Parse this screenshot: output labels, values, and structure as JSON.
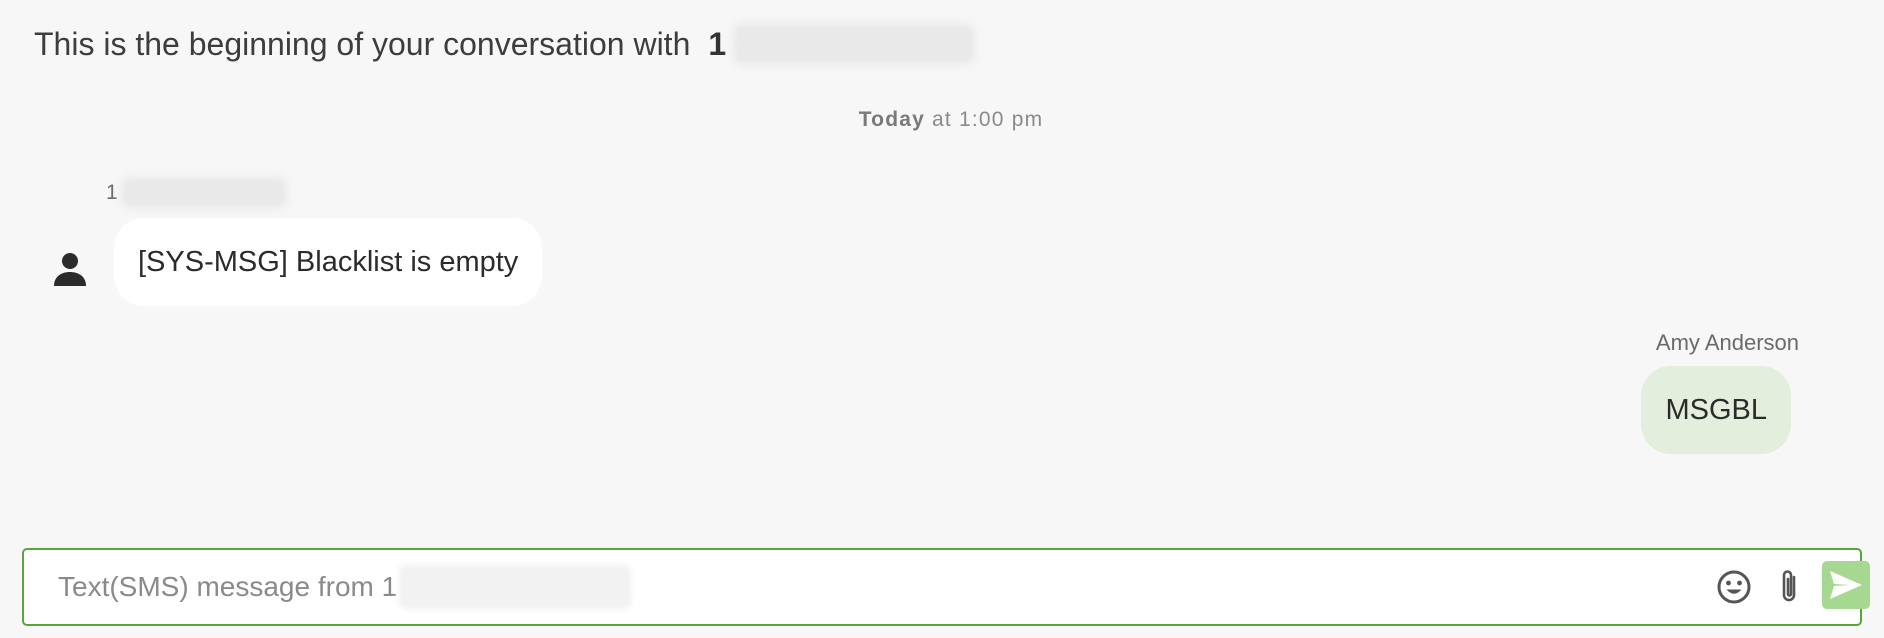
{
  "header": {
    "intro": "This is the beginning of your conversation with",
    "contact_prefix": "1"
  },
  "timestamp": {
    "day": "Today",
    "time": "at 1:00 pm"
  },
  "incoming": {
    "sender_prefix": "1",
    "message": "[SYS-MSG] Blacklist is empty",
    "avatar_icon": "person-icon"
  },
  "outgoing": {
    "agent_name": "Amy Anderson",
    "message": "MSGBL"
  },
  "composer": {
    "placeholder": "Text(SMS) message from 1",
    "emoji_icon": "emoji-icon",
    "attach_icon": "paperclip-icon",
    "send_icon": "send-icon"
  },
  "colors": {
    "background": "#f7f7f7",
    "incoming_bubble": "#ffffff",
    "outgoing_bubble": "#e3efdc",
    "accent_border": "#5aa53a",
    "send_button": "#a6d891"
  }
}
